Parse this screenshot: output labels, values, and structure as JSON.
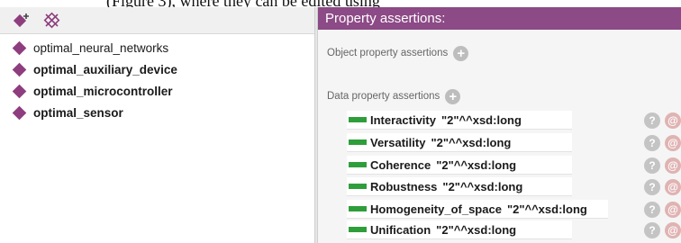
{
  "caption": "(Figure 3), where they can be edited using",
  "left": {
    "toolbar": {
      "add_individual_icon": "diamond-plus-icon",
      "delete_individual_icon": "diamond-x-icon"
    },
    "individuals": [
      {
        "label": "optimal_neural_networks"
      },
      {
        "label": "optimal_auxiliary_device"
      },
      {
        "label": "optimal_microcontroller"
      },
      {
        "label": "optimal_sensor"
      }
    ]
  },
  "right": {
    "header": "Property assertions:",
    "object_section": "Object property assertions",
    "data_section": "Data property assertions",
    "data_assertions": [
      {
        "property": "Interactivity",
        "value": "\"2\"^^xsd:long"
      },
      {
        "property": "Versatility",
        "value": "\"2\"^^xsd:long"
      },
      {
        "property": "Coherence",
        "value": "\"2\"^^xsd:long"
      },
      {
        "property": "Robustness",
        "value": "\"2\"^^xsd:long"
      },
      {
        "property": "Homogeneity_of_space",
        "value": "\"2\"^^xsd:long"
      },
      {
        "property": "Unification",
        "value": "\"2\"^^xsd:long"
      }
    ],
    "add_symbol": "+",
    "help_symbol": "?",
    "annotate_symbol": "@"
  },
  "colors": {
    "accent_purple": "#8c4a86",
    "individual_diamond": "#8e3e7f",
    "data_property_green": "#2e9e3a"
  }
}
